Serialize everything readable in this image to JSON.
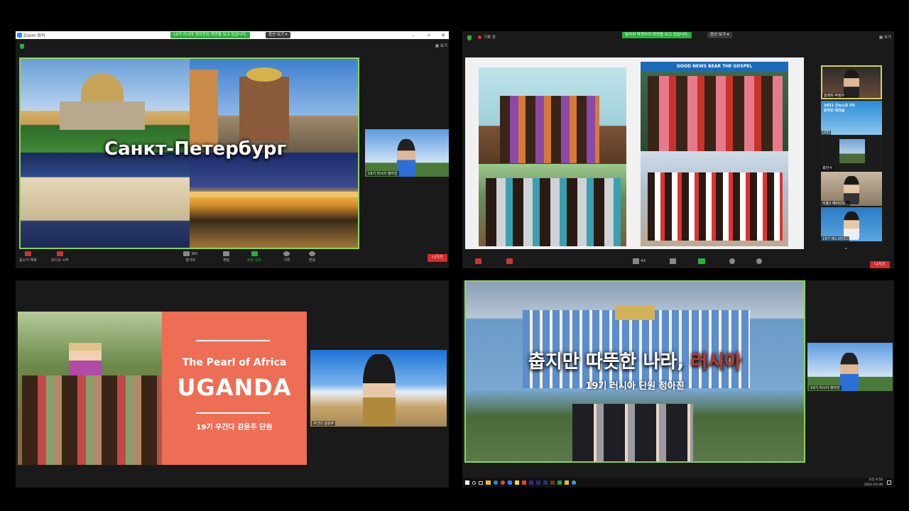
{
  "pane1": {
    "window_title": "Zoom 회의",
    "banner": "19기 러시아 정아진의 화면을 보고 있습니다.",
    "view_options": "옵션 보기 ▾",
    "view_label": "보기",
    "slide_title": "Санкт-Петербург",
    "thumb_name": "19기 러시아 정아진",
    "toolbar": {
      "mute": "음소거 해제",
      "video": "비디오 시작",
      "participants": "참가자",
      "participants_count": "382",
      "chat": "채팅",
      "share": "화면 공유",
      "record": "기록",
      "reactions": "반응"
    },
    "leave": "나가기"
  },
  "pane2": {
    "window_title": "기록 중",
    "banner": "탈라위 박정아의 화면을 보고 있습니다.",
    "view_options": "옵션 보기 ▾",
    "view_label": "보기",
    "banner_photo_text": "GOOD NEWS BEAR THE GOSPEL",
    "gallery": [
      {
        "name": "말레위 박정아"
      },
      {
        "name": "[19] "
      },
      {
        "name": "홍민서"
      },
      {
        "name": "서울2 예비단원..."
      },
      {
        "name": "19기 에스와티..."
      }
    ],
    "gallery_poster_text": "2021 굿뉴스코 3차 온라인 워크숍",
    "participants_count": "43",
    "leave": "나가기"
  },
  "pane3": {
    "slide_subtitle": "The Pearl of Africa",
    "slide_title": "UGANDA",
    "slide_caption": "19기 우간다 강윤주 단원",
    "thumb_name": "우간다 강윤주"
  },
  "pane4": {
    "slide_title_a": "춥지만 따뜻한 나라, ",
    "slide_title_b": "러시아",
    "slide_caption": "19기 러시아 단원 정아진",
    "thumb_name": "19기 러시아 정아진",
    "clock_time": "오전 9:50",
    "clock_date": "2021-01-09"
  }
}
